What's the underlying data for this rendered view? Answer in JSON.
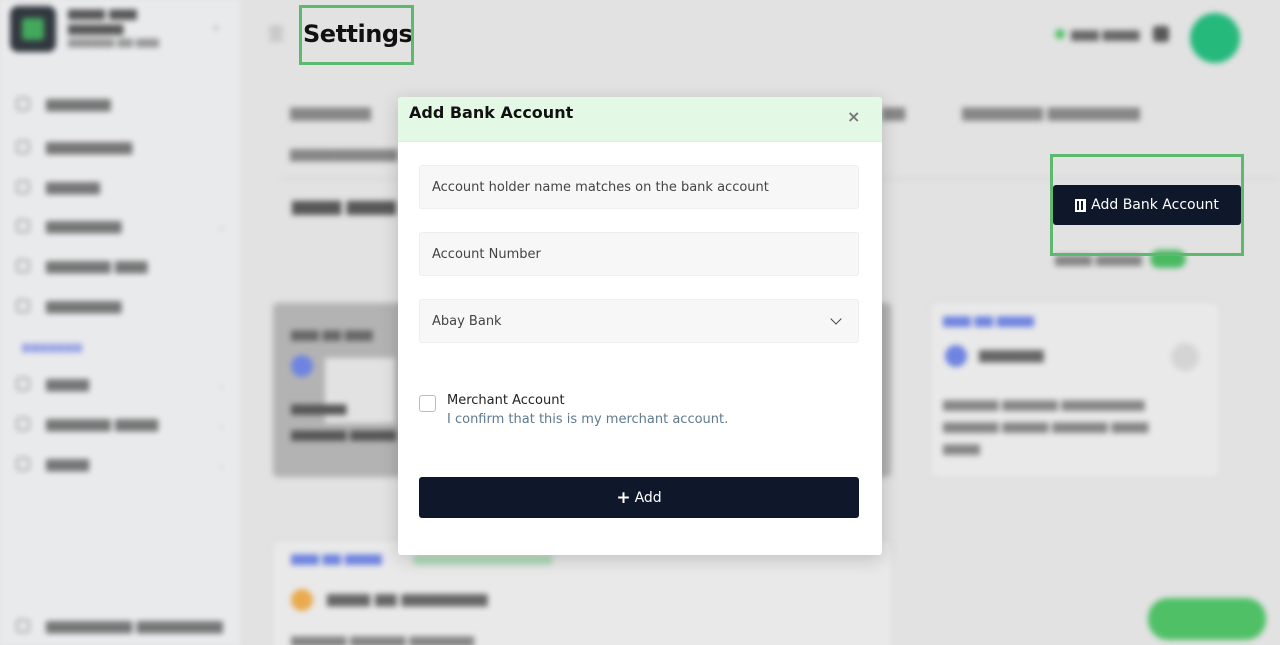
{
  "header": {
    "title": "Settings"
  },
  "toolbar": {
    "add_bank_label": "Add Bank Account"
  },
  "modal": {
    "title": "Add Bank Account",
    "close_glyph": "×",
    "fields": {
      "holder_placeholder": "Account holder name matches on the bank account",
      "number_placeholder": "Account Number",
      "bank_selected": "Abay Bank"
    },
    "merchant": {
      "label": "Merchant Account",
      "description": "I confirm that this is my merchant account."
    },
    "submit_label": "Add"
  },
  "icons": {
    "close": "close-icon",
    "plus": "plus-icon",
    "bank": "bank-icon",
    "chevron": "chevron-down-icon"
  },
  "colors": {
    "primary": "#0f172a",
    "modal_header_bg": "#e3f8e5",
    "highlight": "#5fb86f",
    "description_text": "#5f7a90"
  }
}
